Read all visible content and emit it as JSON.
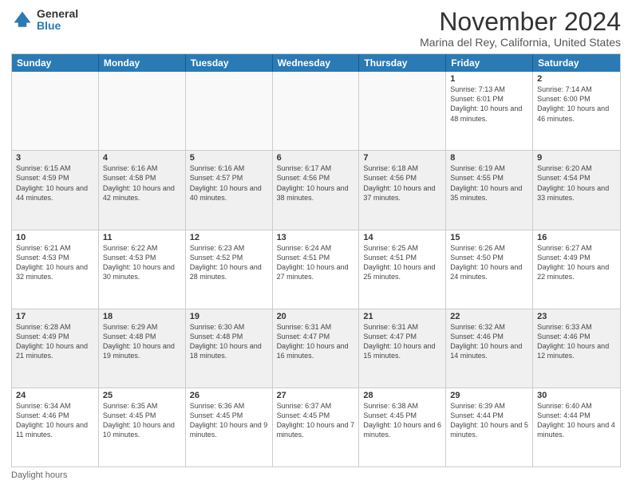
{
  "logo": {
    "general": "General",
    "blue": "Blue"
  },
  "header": {
    "month_title": "November 2024",
    "location": "Marina del Rey, California, United States"
  },
  "calendar": {
    "days_of_week": [
      "Sunday",
      "Monday",
      "Tuesday",
      "Wednesday",
      "Thursday",
      "Friday",
      "Saturday"
    ],
    "footer_note": "Daylight hours"
  },
  "rows": [
    {
      "cells": [
        {
          "day": "",
          "empty": true
        },
        {
          "day": "",
          "empty": true
        },
        {
          "day": "",
          "empty": true
        },
        {
          "day": "",
          "empty": true
        },
        {
          "day": "",
          "empty": true
        },
        {
          "day": "1",
          "sunrise": "Sunrise: 7:13 AM",
          "sunset": "Sunset: 6:01 PM",
          "daylight": "Daylight: 10 hours and 48 minutes."
        },
        {
          "day": "2",
          "sunrise": "Sunrise: 7:14 AM",
          "sunset": "Sunset: 6:00 PM",
          "daylight": "Daylight: 10 hours and 46 minutes."
        }
      ]
    },
    {
      "cells": [
        {
          "day": "3",
          "sunrise": "Sunrise: 6:15 AM",
          "sunset": "Sunset: 4:59 PM",
          "daylight": "Daylight: 10 hours and 44 minutes."
        },
        {
          "day": "4",
          "sunrise": "Sunrise: 6:16 AM",
          "sunset": "Sunset: 4:58 PM",
          "daylight": "Daylight: 10 hours and 42 minutes."
        },
        {
          "day": "5",
          "sunrise": "Sunrise: 6:16 AM",
          "sunset": "Sunset: 4:57 PM",
          "daylight": "Daylight: 10 hours and 40 minutes."
        },
        {
          "day": "6",
          "sunrise": "Sunrise: 6:17 AM",
          "sunset": "Sunset: 4:56 PM",
          "daylight": "Daylight: 10 hours and 38 minutes."
        },
        {
          "day": "7",
          "sunrise": "Sunrise: 6:18 AM",
          "sunset": "Sunset: 4:56 PM",
          "daylight": "Daylight: 10 hours and 37 minutes."
        },
        {
          "day": "8",
          "sunrise": "Sunrise: 6:19 AM",
          "sunset": "Sunset: 4:55 PM",
          "daylight": "Daylight: 10 hours and 35 minutes."
        },
        {
          "day": "9",
          "sunrise": "Sunrise: 6:20 AM",
          "sunset": "Sunset: 4:54 PM",
          "daylight": "Daylight: 10 hours and 33 minutes."
        }
      ]
    },
    {
      "cells": [
        {
          "day": "10",
          "sunrise": "Sunrise: 6:21 AM",
          "sunset": "Sunset: 4:53 PM",
          "daylight": "Daylight: 10 hours and 32 minutes."
        },
        {
          "day": "11",
          "sunrise": "Sunrise: 6:22 AM",
          "sunset": "Sunset: 4:53 PM",
          "daylight": "Daylight: 10 hours and 30 minutes."
        },
        {
          "day": "12",
          "sunrise": "Sunrise: 6:23 AM",
          "sunset": "Sunset: 4:52 PM",
          "daylight": "Daylight: 10 hours and 28 minutes."
        },
        {
          "day": "13",
          "sunrise": "Sunrise: 6:24 AM",
          "sunset": "Sunset: 4:51 PM",
          "daylight": "Daylight: 10 hours and 27 minutes."
        },
        {
          "day": "14",
          "sunrise": "Sunrise: 6:25 AM",
          "sunset": "Sunset: 4:51 PM",
          "daylight": "Daylight: 10 hours and 25 minutes."
        },
        {
          "day": "15",
          "sunrise": "Sunrise: 6:26 AM",
          "sunset": "Sunset: 4:50 PM",
          "daylight": "Daylight: 10 hours and 24 minutes."
        },
        {
          "day": "16",
          "sunrise": "Sunrise: 6:27 AM",
          "sunset": "Sunset: 4:49 PM",
          "daylight": "Daylight: 10 hours and 22 minutes."
        }
      ]
    },
    {
      "cells": [
        {
          "day": "17",
          "sunrise": "Sunrise: 6:28 AM",
          "sunset": "Sunset: 4:49 PM",
          "daylight": "Daylight: 10 hours and 21 minutes."
        },
        {
          "day": "18",
          "sunrise": "Sunrise: 6:29 AM",
          "sunset": "Sunset: 4:48 PM",
          "daylight": "Daylight: 10 hours and 19 minutes."
        },
        {
          "day": "19",
          "sunrise": "Sunrise: 6:30 AM",
          "sunset": "Sunset: 4:48 PM",
          "daylight": "Daylight: 10 hours and 18 minutes."
        },
        {
          "day": "20",
          "sunrise": "Sunrise: 6:31 AM",
          "sunset": "Sunset: 4:47 PM",
          "daylight": "Daylight: 10 hours and 16 minutes."
        },
        {
          "day": "21",
          "sunrise": "Sunrise: 6:31 AM",
          "sunset": "Sunset: 4:47 PM",
          "daylight": "Daylight: 10 hours and 15 minutes."
        },
        {
          "day": "22",
          "sunrise": "Sunrise: 6:32 AM",
          "sunset": "Sunset: 4:46 PM",
          "daylight": "Daylight: 10 hours and 14 minutes."
        },
        {
          "day": "23",
          "sunrise": "Sunrise: 6:33 AM",
          "sunset": "Sunset: 4:46 PM",
          "daylight": "Daylight: 10 hours and 12 minutes."
        }
      ]
    },
    {
      "cells": [
        {
          "day": "24",
          "sunrise": "Sunrise: 6:34 AM",
          "sunset": "Sunset: 4:46 PM",
          "daylight": "Daylight: 10 hours and 11 minutes."
        },
        {
          "day": "25",
          "sunrise": "Sunrise: 6:35 AM",
          "sunset": "Sunset: 4:45 PM",
          "daylight": "Daylight: 10 hours and 10 minutes."
        },
        {
          "day": "26",
          "sunrise": "Sunrise: 6:36 AM",
          "sunset": "Sunset: 4:45 PM",
          "daylight": "Daylight: 10 hours and 9 minutes."
        },
        {
          "day": "27",
          "sunrise": "Sunrise: 6:37 AM",
          "sunset": "Sunset: 4:45 PM",
          "daylight": "Daylight: 10 hours and 7 minutes."
        },
        {
          "day": "28",
          "sunrise": "Sunrise: 6:38 AM",
          "sunset": "Sunset: 4:45 PM",
          "daylight": "Daylight: 10 hours and 6 minutes."
        },
        {
          "day": "29",
          "sunrise": "Sunrise: 6:39 AM",
          "sunset": "Sunset: 4:44 PM",
          "daylight": "Daylight: 10 hours and 5 minutes."
        },
        {
          "day": "30",
          "sunrise": "Sunrise: 6:40 AM",
          "sunset": "Sunset: 4:44 PM",
          "daylight": "Daylight: 10 hours and 4 minutes."
        }
      ]
    }
  ]
}
